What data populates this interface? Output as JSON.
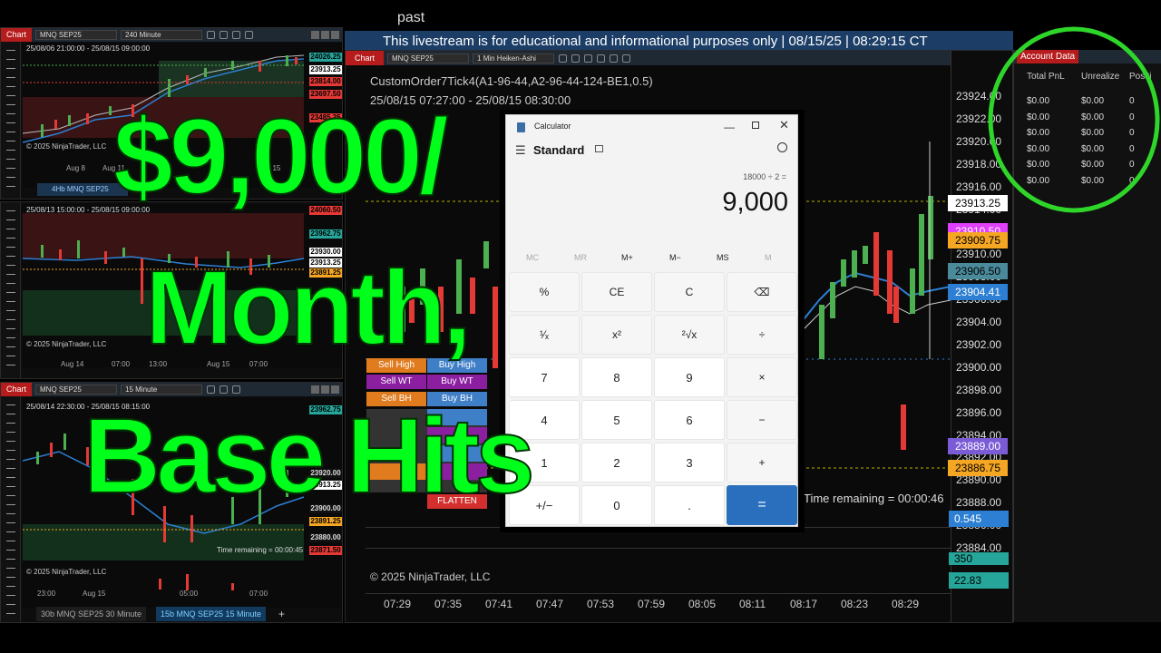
{
  "banner": {
    "top_label": "past",
    "text": "This livestream is for educational and informational purposes only | 08/15/25 | 08:29:15 CT"
  },
  "chart_tab_label": "Chart",
  "copyright": "© 2025 NinjaTrader, LLC",
  "copyright_main": "© 2025 NinjaTrader, LLC",
  "panels": {
    "top_left": {
      "instrument": "MNQ SEP25",
      "interval": "240 Minute",
      "range": "25/08/06 21:00:00 - 25/08/15 09:00:00",
      "tags": [
        {
          "text": "24026.25",
          "color": "#26a69a"
        },
        {
          "text": "23913.25",
          "color": "#ffffff"
        },
        {
          "text": "23814.00",
          "color": "#e53935"
        },
        {
          "text": "23697.50",
          "color": "#e53935"
        },
        {
          "text": "23485.25",
          "color": "#e53935"
        }
      ],
      "x_labels": [
        "Aug 8",
        "Aug 11",
        "Aug 15"
      ],
      "sub_tab": "4Hb MNQ SEP25"
    },
    "mid_left": {
      "range": "25/08/13 15:00:00 - 25/08/15 09:00:00",
      "tags": [
        {
          "text": "24060.50",
          "color": "#e53935"
        },
        {
          "text": "23962.75",
          "color": "#26a69a"
        },
        {
          "text": "23930.00",
          "color": "#ffffff"
        },
        {
          "text": "23913.25",
          "color": "#ffffff"
        },
        {
          "text": "23891.25",
          "color": "#f5a623"
        }
      ],
      "x_labels": [
        "Aug 14",
        "07:00",
        "13:00",
        "Aug 15",
        "07:00"
      ]
    },
    "bottom_left": {
      "instrument": "MNQ SEP25",
      "interval": "15 Minute",
      "range": "25/08/14 22:30:00 - 25/08/15 08:15:00",
      "tags": [
        {
          "text": "23962.75",
          "color": "#26a69a"
        },
        {
          "text": "23920.00",
          "color": "#dddddd"
        },
        {
          "text": "23913.25",
          "color": "#ffffff"
        },
        {
          "text": "23900.00",
          "color": "#dddddd"
        },
        {
          "text": "23891.25",
          "color": "#f5a623"
        },
        {
          "text": "23880.00",
          "color": "#dddddd"
        },
        {
          "text": "23871.50",
          "color": "#e53935"
        }
      ],
      "time_remaining": "Time remaining = 00:00:45",
      "x_labels": [
        "23:00",
        "Aug 15",
        "05:00",
        "07:00"
      ]
    }
  },
  "bottom_tabs": [
    "30b MNQ SEP25 30 Minute",
    "15b MNQ SEP25 15 Minute",
    "+"
  ],
  "main_chart": {
    "instrument": "MNQ SEP25",
    "interval": "1 Min Heiken-Ashi",
    "indicator": "CustomOrder7Tick4(A1-96-44,A2-96-44-124-BE1,0.5)",
    "range": "25/08/15 07:27:00 - 25/08/15 08:30:00",
    "y_ticks": [
      "23924.00",
      "23922.00",
      "23920.00",
      "23918.00",
      "23916.00",
      "23914.00",
      "23912.00",
      "23910.00",
      "23908.00",
      "23906.00",
      "23904.00",
      "23902.00",
      "23900.00",
      "23898.00",
      "23896.00",
      "23894.00",
      "23892.00",
      "23890.00",
      "23888.00",
      "23886.00",
      "23884.00"
    ],
    "price_tags": [
      {
        "text": "23913.25",
        "bg": "#ffffff",
        "fg": "#000000"
      },
      {
        "text": "23910.50",
        "bg": "#e040fb",
        "fg": "#ffffff"
      },
      {
        "text": "23909.75",
        "bg": "#f5a623",
        "fg": "#000000"
      },
      {
        "text": "23906.50",
        "bg": "#4a8a9a",
        "fg": "#000000"
      },
      {
        "text": "23904.41",
        "bg": "#2d7fd3",
        "fg": "#ffffff"
      },
      {
        "text": "23889.00",
        "bg": "#7b5cd6",
        "fg": "#ffffff"
      },
      {
        "text": "23886.75",
        "bg": "#f5a623",
        "fg": "#000000"
      }
    ],
    "time_remaining": "Time remaining = 00:00:46",
    "sub_values": [
      {
        "text": "0.545",
        "bg": "#2d7fd3"
      },
      {
        "text": "350",
        "bg": "#26a69a"
      },
      {
        "text": "22.83",
        "bg": "#26a69a"
      }
    ],
    "time_ticks": [
      "07:29",
      "07:35",
      "07:41",
      "07:47",
      "07:53",
      "07:59",
      "08:05",
      "08:11",
      "08:17",
      "08:23",
      "08:29"
    ]
  },
  "order_buttons": [
    {
      "label": "Sell High",
      "color": "#e07b1e"
    },
    {
      "label": "Buy High",
      "color": "#3f7fc8"
    },
    {
      "label": "Sell WT",
      "color": "#8b1fa0"
    },
    {
      "label": "Buy WT",
      "color": "#8b1fa0"
    },
    {
      "label": "Sell BH",
      "color": "#e07b1e"
    },
    {
      "label": "Buy BH",
      "color": "#3f7fc8"
    },
    {
      "label": "FLATTEN",
      "color": "#d32f2f"
    }
  ],
  "calculator": {
    "title": "Calculator",
    "mode": "Standard",
    "expression": "18000 ÷ 2 =",
    "display": "9,000",
    "memory": [
      {
        "label": "MC",
        "enabled": false
      },
      {
        "label": "MR",
        "enabled": false
      },
      {
        "label": "M+",
        "enabled": true
      },
      {
        "label": "M−",
        "enabled": true
      },
      {
        "label": "MS",
        "enabled": true
      },
      {
        "label": "M",
        "enabled": false
      }
    ],
    "keys": [
      [
        "%",
        "CE",
        "C",
        "⌫"
      ],
      [
        "¹⁄ₓ",
        "x²",
        "²√x",
        "÷"
      ],
      [
        "7",
        "8",
        "9",
        "×"
      ],
      [
        "4",
        "5",
        "6",
        "−"
      ],
      [
        "1",
        "2",
        "3",
        "+"
      ],
      [
        "+/−",
        "0",
        ".",
        "="
      ]
    ]
  },
  "account": {
    "title": "Account Data",
    "headers": [
      "Total PnL",
      "Unrealize",
      "Positi"
    ],
    "rows": [
      [
        "$0.00",
        "$0.00",
        "0"
      ],
      [
        "$0.00",
        "$0.00",
        "0"
      ],
      [
        "$0.00",
        "$0.00",
        "0"
      ],
      [
        "$0.00",
        "$0.00",
        "0"
      ],
      [
        "$0.00",
        "$0.00",
        "0"
      ],
      [
        "$0.00",
        "$0.00",
        "0"
      ]
    ]
  },
  "overlay": {
    "line1": "$9,000/",
    "line2": "Month,",
    "line3": "Base Hits"
  },
  "colors": {
    "overlay_green": "#00ff1a",
    "bull": "#4caf50",
    "bear": "#e53935",
    "chart_tab": "#b71c1c"
  }
}
